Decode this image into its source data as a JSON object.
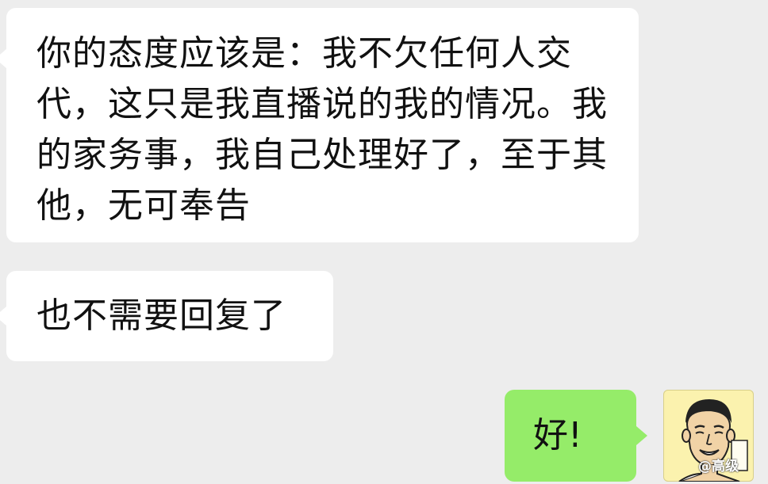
{
  "chat": {
    "messages": [
      {
        "side": "incoming",
        "text": "你的态度应该是：我不欠任何人交代，这只是我直播说的我的情况。我的家务事，我自己处理好了，至于其他，无可奉告"
      },
      {
        "side": "incoming",
        "text": "也不需要回复了"
      },
      {
        "side": "outgoing",
        "text": "好!"
      }
    ],
    "avatar": {
      "icon": "cartoon-avatar-icon",
      "text": "高级"
    },
    "watermark": "@高级"
  },
  "colors": {
    "background": "#ededed",
    "incoming_bubble": "#ffffff",
    "outgoing_bubble": "#95ec69",
    "avatar_bg": "#fbf2ae"
  }
}
